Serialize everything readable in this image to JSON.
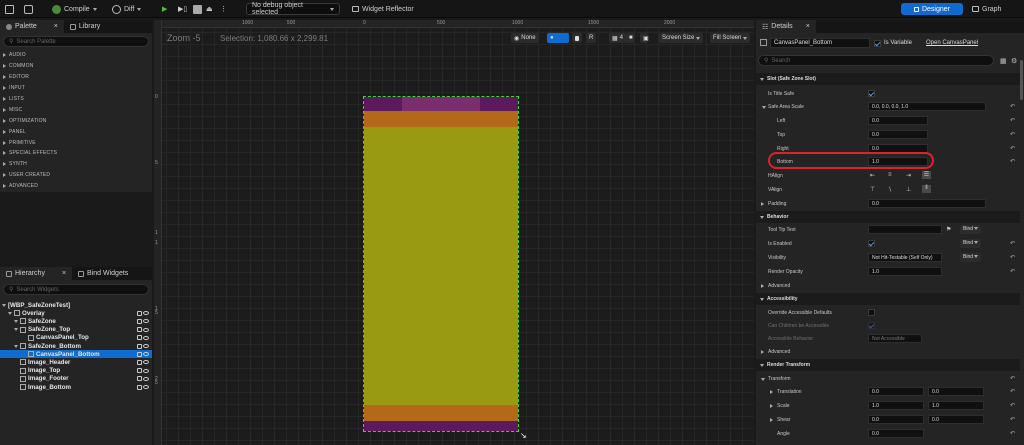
{
  "toolbar": {
    "compile": "Compile",
    "diff": "Diff",
    "debug_select": "No debug object selected",
    "widget_reflector": "Widget Reflector",
    "designer": "Designer",
    "graph": "Graph"
  },
  "palette": {
    "tab": "Palette",
    "library_tab": "Library",
    "search_placeholder": "Search Palette",
    "categories": [
      "AUDIO",
      "COMMON",
      "EDITOR",
      "INPUT",
      "LISTS",
      "MISC",
      "OPTIMIZATION",
      "PANEL",
      "PRIMITIVE",
      "SPECIAL EFFECTS",
      "SYNTH",
      "USER CREATED",
      "ADVANCED"
    ]
  },
  "hierarchy": {
    "tab": "Hierarchy",
    "bind_tab": "Bind Widgets",
    "search_placeholder": "Search Widgets",
    "items": [
      "[WBP_SafeZoneTest]",
      "Overlay",
      "SafeZone",
      "SafeZone_Top",
      "CanvasPanel_Top",
      "SafeZone_Bottom",
      "CanvasPanel_Bottom",
      "Image_Header",
      "Image_Top",
      "Image_Footer",
      "Image_Bottom"
    ]
  },
  "canvas": {
    "zoom": "Zoom -5",
    "selection": "Selection: 1,080.66 x 2,299.81",
    "ruler": [
      "1000",
      "500",
      "0",
      "500",
      "1000",
      "1500",
      "2000"
    ],
    "vruler": [
      "0",
      "5",
      "1",
      "1",
      "1",
      "5",
      "2",
      "5"
    ],
    "none_label": "None",
    "r_label": "R",
    "grid_num": "4",
    "screen_size": "Screen Size",
    "fill_screen": "Fill Screen",
    "colors": {
      "header": "#5c1a5c",
      "header_mid": "#7a2e6e",
      "orange": "#b3681a",
      "yellow": "#9a9a12",
      "bottom": "#5c1a5c",
      "outline": "#3ad83a"
    }
  },
  "details": {
    "tab": "Details",
    "widget_name": "CanvasPanel_Bottom",
    "is_variable": "Is Variable",
    "open_link": "Open CanvasPanel",
    "search_placeholder": "Search",
    "slot_header": "Slot (Safe Zone Slot)",
    "is_title_safe": "Is Title Safe",
    "safe_area_scale": "Safe Area Scale",
    "safe_area_value": "0.0, 0.0, 0.0, 1.0",
    "left": "Left",
    "left_val": "0.0",
    "top": "Top",
    "top_val": "0.0",
    "right": "Right",
    "right_val": "0.0",
    "bottom": "Bottom",
    "bottom_val": "1.0",
    "halign": "HAlign",
    "valign": "VAlign",
    "padding": "Padding",
    "padding_val": "0.0",
    "behavior": "Behavior",
    "tooltip": "Tool Tip Text",
    "is_enabled": "Is Enabled",
    "visibility": "Visibility",
    "visibility_val": "Not Hit-Testable (Self Only)",
    "render_opacity": "Render Opacity",
    "render_opacity_val": "1.0",
    "advanced": "Advanced",
    "bind": "Bind",
    "accessibility": "Accessibility",
    "override_acc": "Override Accessible Defaults",
    "can_children": "Can Children be Accessible",
    "acc_behavior": "Accessible Behavior",
    "acc_behavior_val": "Not Accessible",
    "advanced2": "Advanced",
    "render_transform": "Render Transform",
    "transform": "Transform",
    "translation": "Translation",
    "t1": "0.0",
    "t2": "0.0",
    "scale": "Scale",
    "s1": "1.0",
    "s2": "1.0",
    "shear": "Shear",
    "sh1": "0.0",
    "sh2": "0.0",
    "angle": "Angle",
    "angle_val": "0.0"
  },
  "highlight_color": "#e0202a"
}
